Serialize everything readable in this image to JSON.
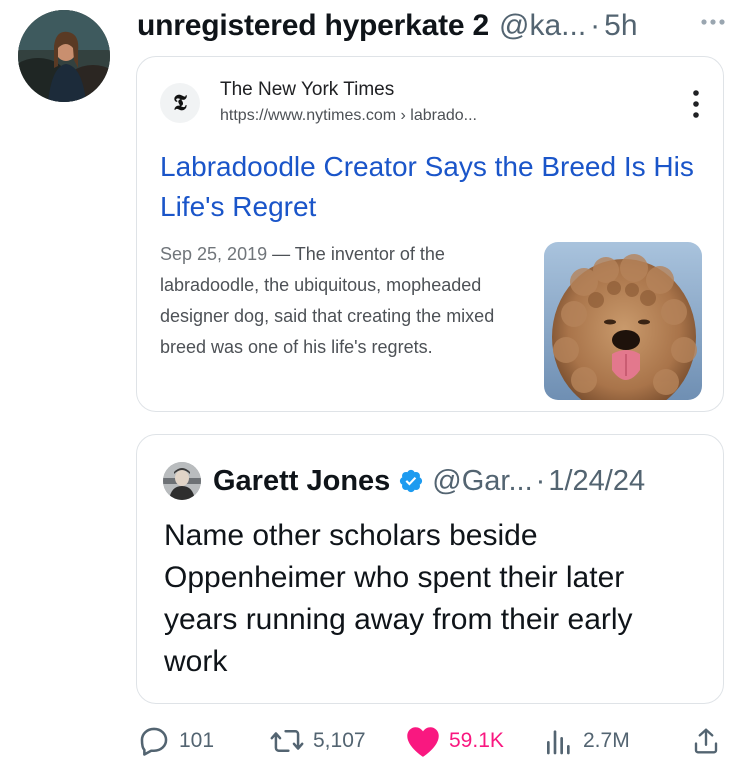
{
  "tweet": {
    "display_name": "unregistered hyperkate 2",
    "handle": "@ka...",
    "separator": "·",
    "time": "5h"
  },
  "link_card": {
    "site_name": "The New York Times",
    "site_url": "https://www.nytimes.com › labrado...",
    "site_logo_glyph": "𝕿",
    "title": "Labradoodle Creator Says the Breed Is His Life's Regret",
    "date": "Sep 25, 2019",
    "dash": " — ",
    "snippet": "The inventor of the labradoodle, the ubiquitous, mopheaded designer dog, said that creating the mixed breed was one of his life's regrets."
  },
  "quoted_tweet": {
    "display_name": "Garett Jones",
    "handle": "@Gar...",
    "separator": "·",
    "date": "1/24/24",
    "text": "Name other scholars beside Oppenheimer who spent their later years running away from their early work"
  },
  "actions": {
    "replies": "101",
    "reposts": "5,107",
    "likes": "59.1K",
    "views": "2.7M"
  },
  "colors": {
    "link_blue": "#1a55c9",
    "like_pink": "#f91880",
    "verified_blue": "#1d9bf0",
    "secondary_text": "#536471"
  },
  "icons": [
    "more-icon",
    "kebab-icon",
    "verified-badge-icon",
    "reply-icon",
    "repost-icon",
    "like-icon",
    "views-icon",
    "share-icon"
  ]
}
